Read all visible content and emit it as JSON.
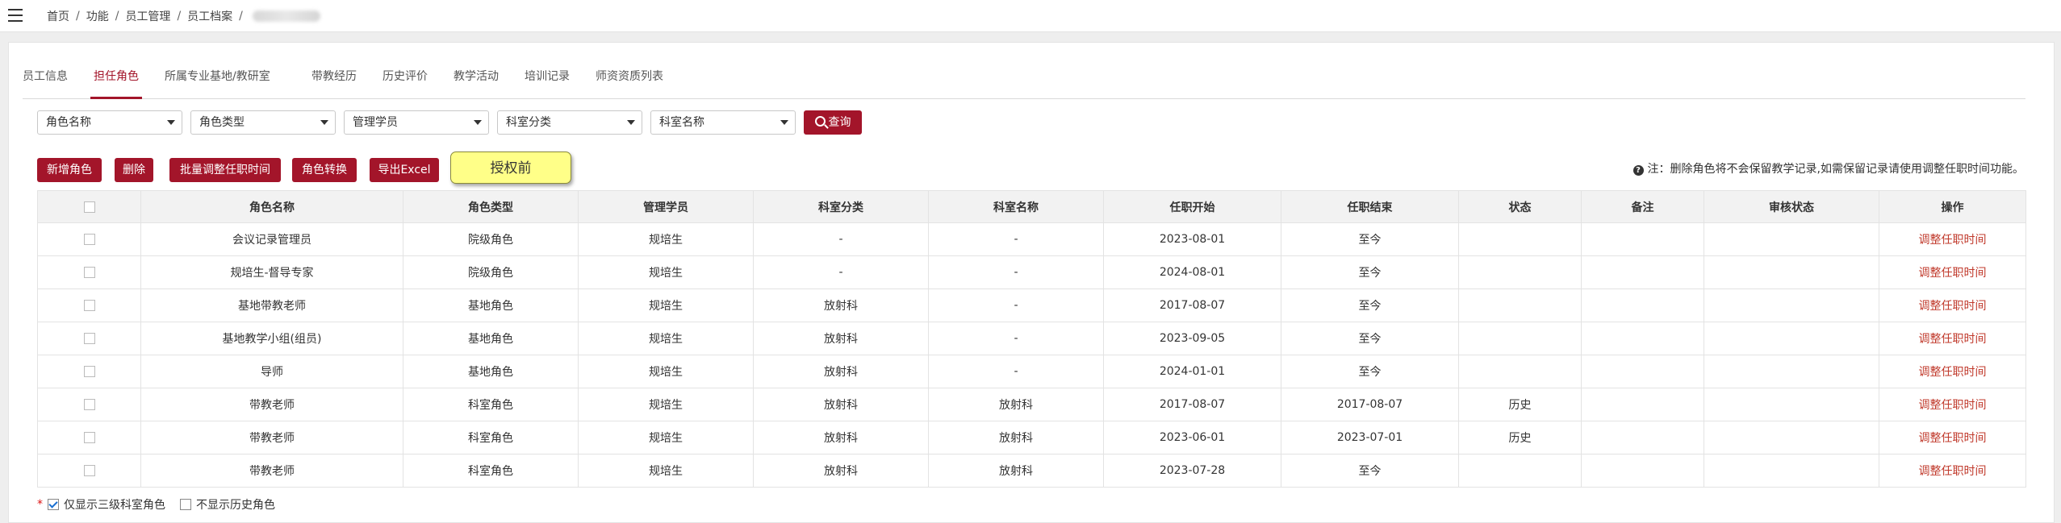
{
  "breadcrumb": {
    "items": [
      "首页",
      "功能",
      "员工管理",
      "员工档案"
    ],
    "sep": "/"
  },
  "tabs": [
    {
      "label": "员工信息"
    },
    {
      "label": "担任角色"
    },
    {
      "label": "所属专业基地/教研室"
    },
    {
      "label": "带教经历"
    },
    {
      "label": "历史评价"
    },
    {
      "label": "教学活动"
    },
    {
      "label": "培训记录"
    },
    {
      "label": "师资资质列表"
    }
  ],
  "filters": {
    "role_name": "角色名称",
    "role_type": "角色类型",
    "student": "管理学员",
    "dept_category": "科室分类",
    "dept_name": "科室名称",
    "search_label": "查询"
  },
  "actions": {
    "add": "新增角色",
    "delete": "删除",
    "batch_adjust": "批量调整任职时间",
    "convert": "角色转换",
    "export": "导出Excel",
    "auth": "授权前"
  },
  "note": "注：删除角色将不会保留教学记录,如需保留记录请使用调整任职时间功能。",
  "table": {
    "headers": [
      "角色名称",
      "角色类型",
      "管理学员",
      "科室分类",
      "科室名称",
      "任职开始",
      "任职结束",
      "状态",
      "备注",
      "审核状态",
      "操作"
    ],
    "rows": [
      [
        "会议记录管理员",
        "院级角色",
        "规培生",
        "-",
        "-",
        "2023-08-01",
        "至今",
        "",
        "",
        "",
        "调整任职时间"
      ],
      [
        "规培生-督导专家",
        "院级角色",
        "规培生",
        "-",
        "-",
        "2024-08-01",
        "至今",
        "",
        "",
        "",
        "调整任职时间"
      ],
      [
        "基地带教老师",
        "基地角色",
        "规培生",
        "放射科",
        "-",
        "2017-08-07",
        "至今",
        "",
        "",
        "",
        "调整任职时间"
      ],
      [
        "基地教学小组(组员)",
        "基地角色",
        "规培生",
        "放射科",
        "-",
        "2023-09-05",
        "至今",
        "",
        "",
        "",
        "调整任职时间"
      ],
      [
        "导师",
        "基地角色",
        "规培生",
        "放射科",
        "-",
        "2024-01-01",
        "至今",
        "",
        "",
        "",
        "调整任职时间"
      ],
      [
        "带教老师",
        "科室角色",
        "规培生",
        "放射科",
        "放射科",
        "2017-08-07",
        "2017-08-07",
        "历史",
        "",
        "",
        "调整任职时间"
      ],
      [
        "带教老师",
        "科室角色",
        "规培生",
        "放射科",
        "放射科",
        "2023-06-01",
        "2023-07-01",
        "历史",
        "",
        "",
        "调整任职时间"
      ],
      [
        "带教老师",
        "科室角色",
        "规培生",
        "放射科",
        "放射科",
        "2023-07-28",
        "至今",
        "",
        "",
        "",
        "调整任职时间"
      ]
    ]
  },
  "options": {
    "star": "*",
    "only_level3": "仅显示三级科室角色",
    "only_level3_checked": true,
    "hide_history": "不显示历史角色",
    "hide_history_checked": false
  },
  "colors": {
    "accent": "#a3152a",
    "link": "#c0392b",
    "auth_button": "#ffff88"
  }
}
